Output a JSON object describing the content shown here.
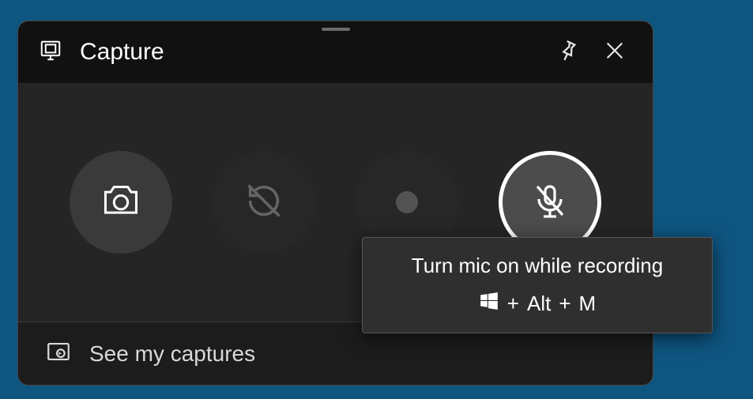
{
  "title": "Capture",
  "footer": {
    "label": "See my captures"
  },
  "tooltip": {
    "title": "Turn mic on while recording",
    "shortcut_plus": "+",
    "shortcut_key1": "Alt",
    "shortcut_key2": "M"
  },
  "icons": {
    "capture_widget": "capture-widget-icon",
    "pin": "pin-icon",
    "close": "close-icon",
    "camera": "camera-icon",
    "last_recording": "refresh-disabled-icon",
    "record": "record-dot-icon",
    "mic_muted": "mic-muted-icon",
    "gallery": "gallery-icon",
    "windows": "windows-logo-icon"
  }
}
